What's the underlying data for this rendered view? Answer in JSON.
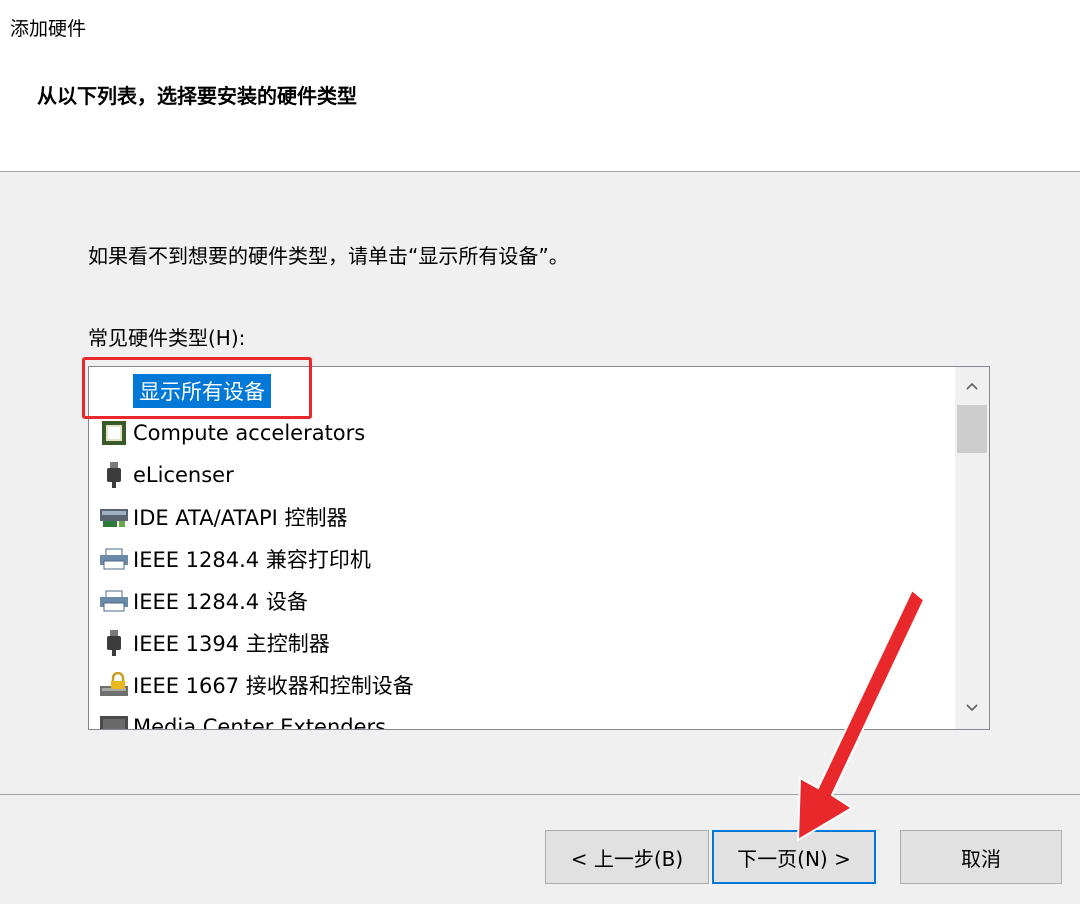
{
  "window": {
    "title": "添加硬件"
  },
  "header": {
    "heading": "从以下列表，选择要安装的硬件类型"
  },
  "content": {
    "hint": "如果看不到想要的硬件类型，请单击“显示所有设备”。",
    "list_label": "常见硬件类型(H):",
    "items": [
      {
        "label": "显示所有设备",
        "icon": "none",
        "selected": true
      },
      {
        "label": "Compute accelerators",
        "icon": "chip-icon"
      },
      {
        "label": "eLicenser",
        "icon": "usb-plug-icon"
      },
      {
        "label": "IDE ATA/ATAPI 控制器",
        "icon": "ide-controller-icon"
      },
      {
        "label": "IEEE 1284.4 兼容打印机",
        "icon": "printer-icon"
      },
      {
        "label": "IEEE 1284.4 设备",
        "icon": "printer-icon"
      },
      {
        "label": "IEEE 1394 主控制器",
        "icon": "usb-plug-icon"
      },
      {
        "label": "IEEE 1667 接收器和控制设备",
        "icon": "lock-drive-icon"
      },
      {
        "label": "Media Center Extenders",
        "icon": "media-extender-icon"
      }
    ]
  },
  "footer": {
    "back_label": "< 上一步(B)",
    "next_label": "下一页(N) >",
    "cancel_label": "取消"
  },
  "colors": {
    "selection": "#0078d7",
    "highlight_box": "#e8282b",
    "arrow": "#e8282b"
  }
}
